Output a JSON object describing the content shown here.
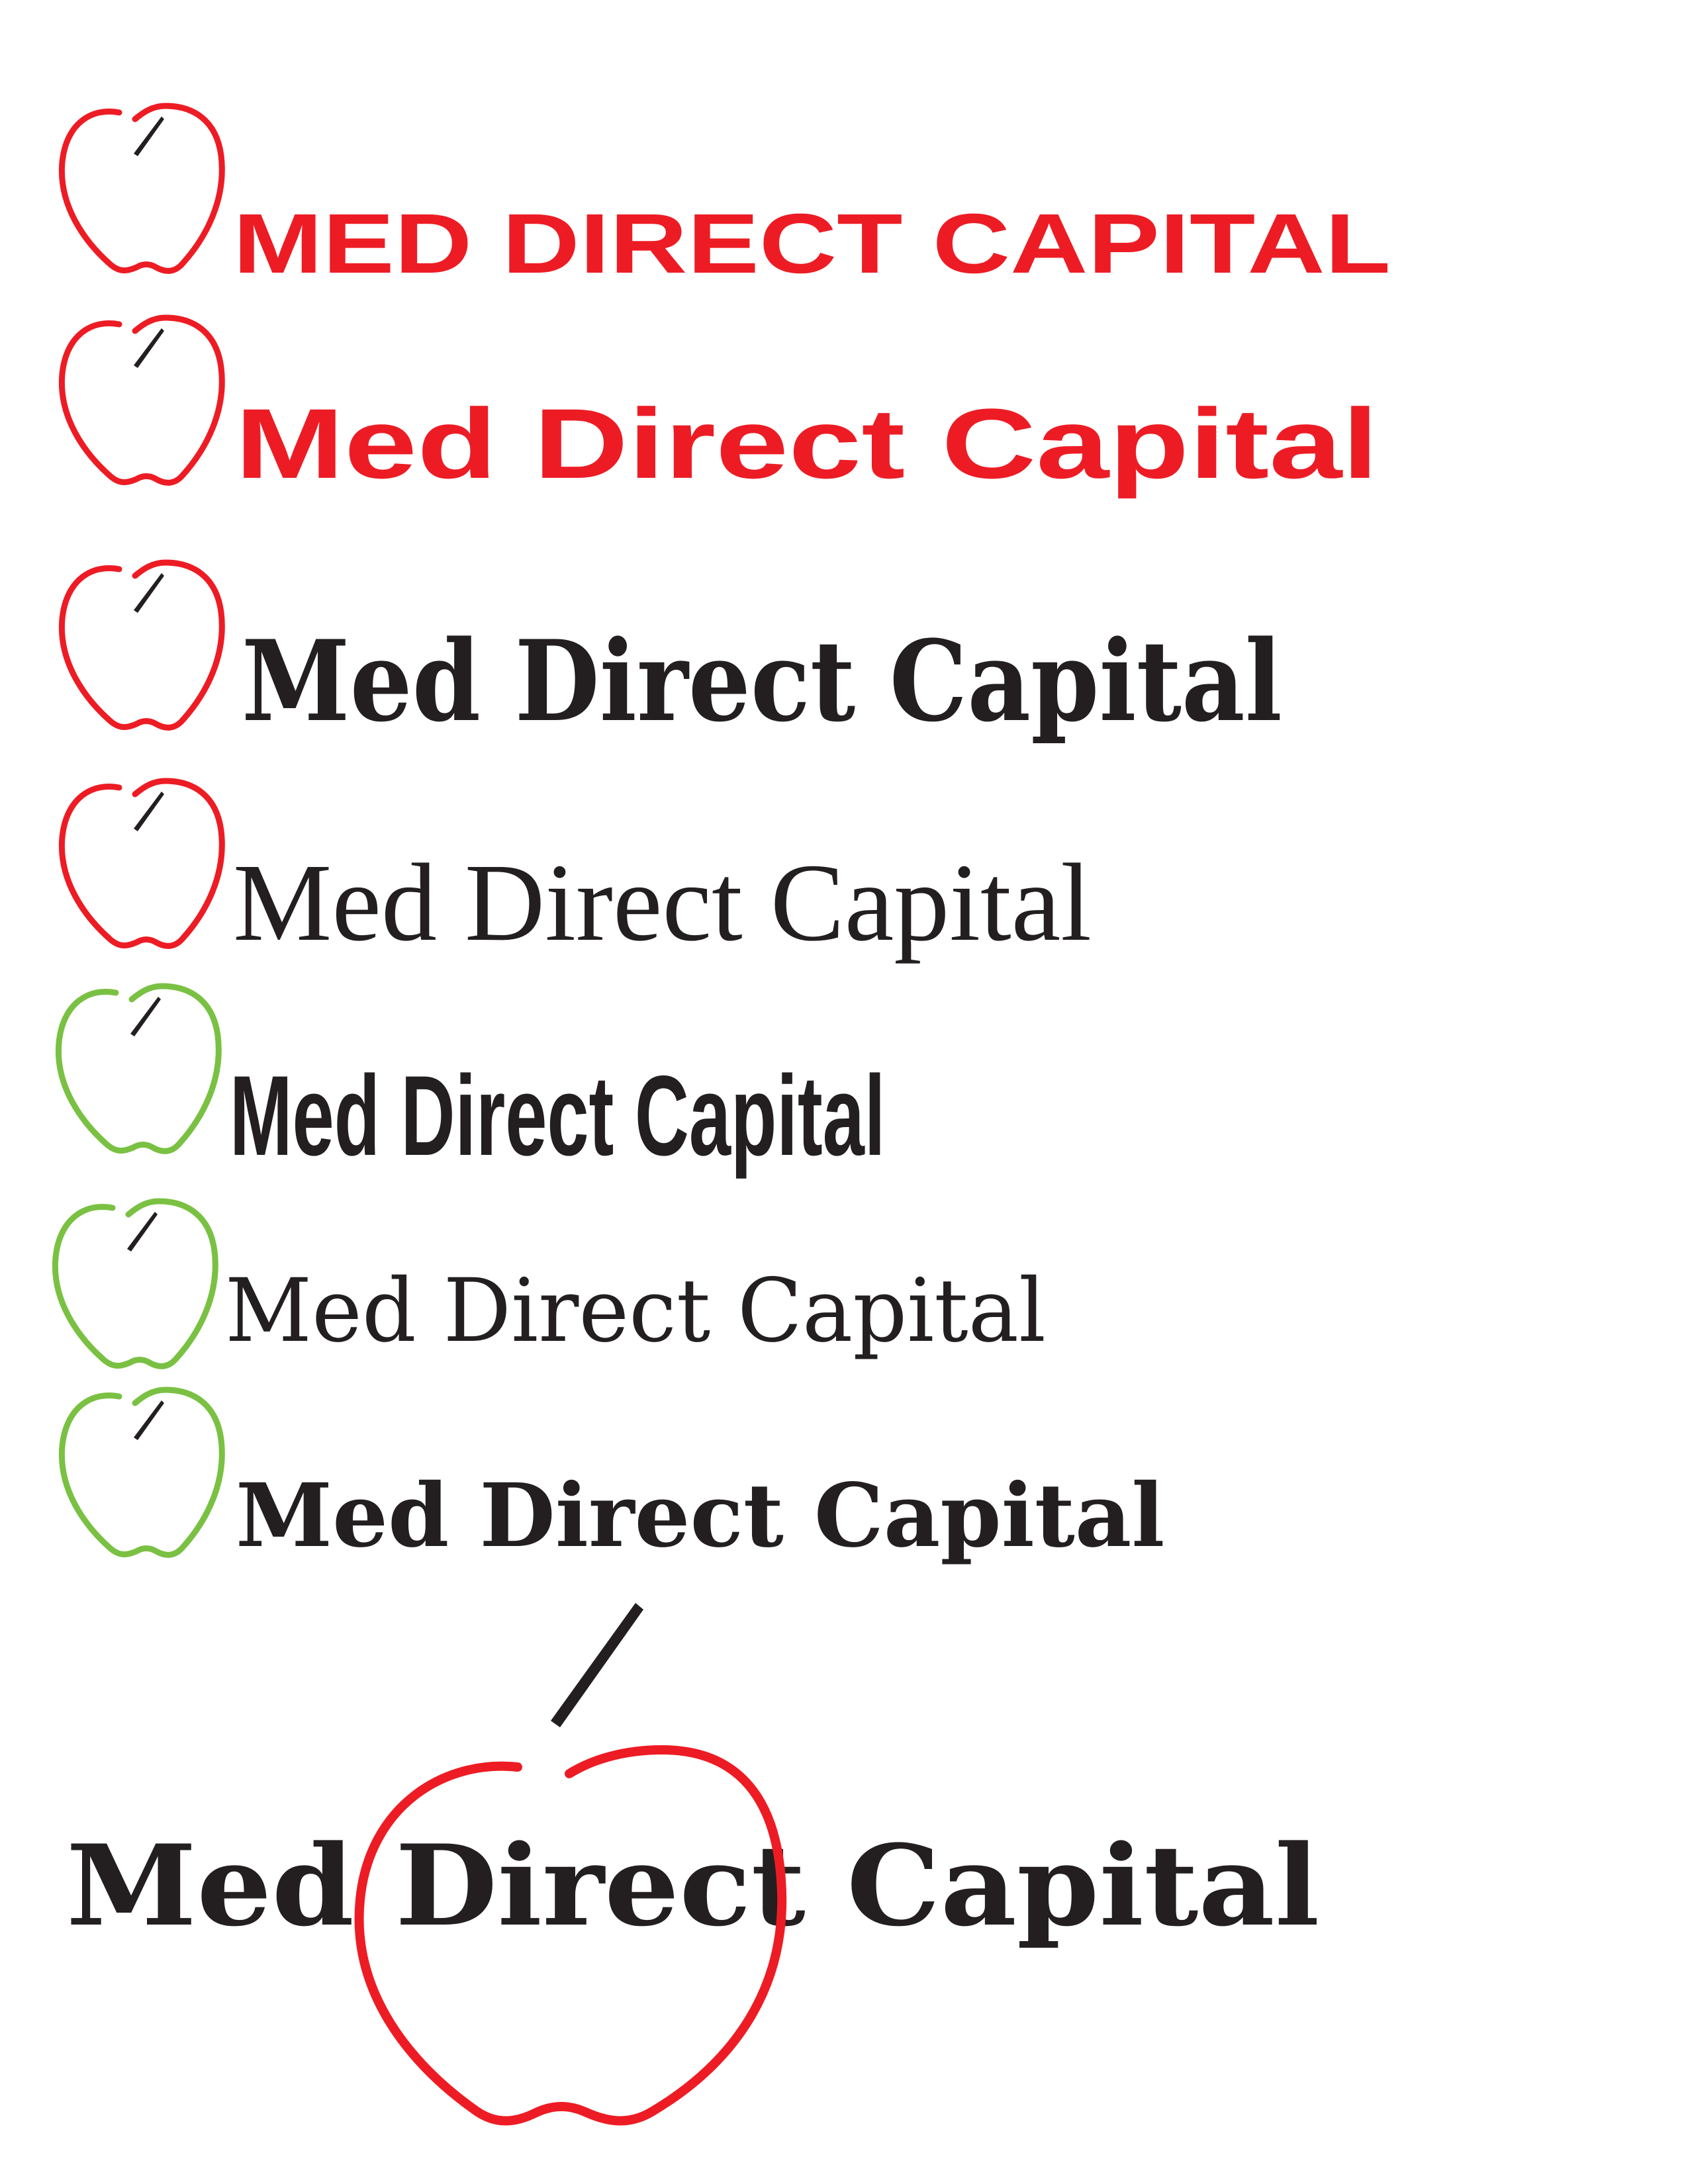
{
  "colors": {
    "red": "#ed1c24",
    "green": "#7ac143",
    "black": "#231f20",
    "background": "#ffffff"
  },
  "logos": [
    {
      "text": "MED DIRECT CAPITAL",
      "apple_color": "red",
      "text_color": "red",
      "apple_icon": "apple-outline-icon"
    },
    {
      "text": "Med Direct Capital",
      "apple_color": "red",
      "text_color": "red",
      "apple_icon": "apple-outline-icon"
    },
    {
      "text": "Med Direct Capital",
      "apple_color": "red",
      "text_color": "black",
      "apple_icon": "apple-outline-icon"
    },
    {
      "text": "Med Direct Capital",
      "apple_color": "red",
      "text_color": "black",
      "apple_icon": "apple-outline-icon"
    },
    {
      "text": "Med Direct Capital",
      "apple_color": "green",
      "text_color": "black",
      "apple_icon": "apple-outline-icon"
    },
    {
      "text": "Med Direct Capital",
      "apple_color": "green",
      "text_color": "black",
      "apple_icon": "apple-outline-icon"
    },
    {
      "text": "Med Direct Capital",
      "apple_color": "green",
      "text_color": "black",
      "apple_icon": "apple-outline-icon"
    },
    {
      "text": "Med Direct Capital",
      "apple_color": "red",
      "text_color": "black",
      "apple_icon": "apple-outline-icon"
    }
  ]
}
